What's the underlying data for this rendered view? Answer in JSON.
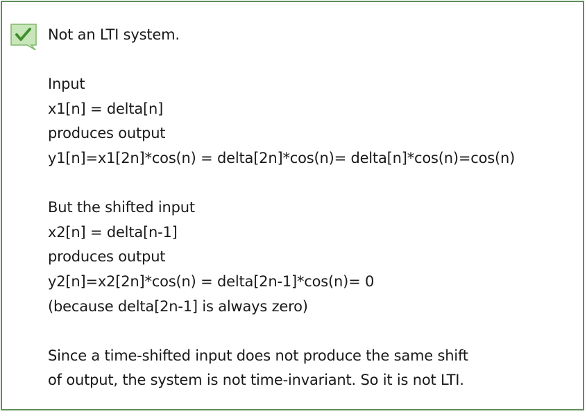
{
  "feedback": {
    "status_icon": "checkmark-icon",
    "status": "correct",
    "accent_color": "#5f8f5b",
    "icon_fill": "#c8e6b9",
    "icon_check": "#3f8f2f",
    "lines": [
      "Not an LTI system.",
      "",
      "Input",
      "x1[n] = delta[n]",
      "produces output",
      "y1[n]=x1[2n]*cos(n) = delta[2n]*cos(n)= delta[n]*cos(n)=cos(n)",
      "",
      "But the shifted input",
      "x2[n] = delta[n-1]",
      "produces output",
      "y2[n]=x2[2n]*cos(n) = delta[2n-1]*cos(n)= 0",
      "(because delta[2n-1] is always zero)",
      "",
      "Since a time-shifted input does not produce the same shift",
      "of output, the system is not time-invariant. So it is not LTI."
    ]
  }
}
